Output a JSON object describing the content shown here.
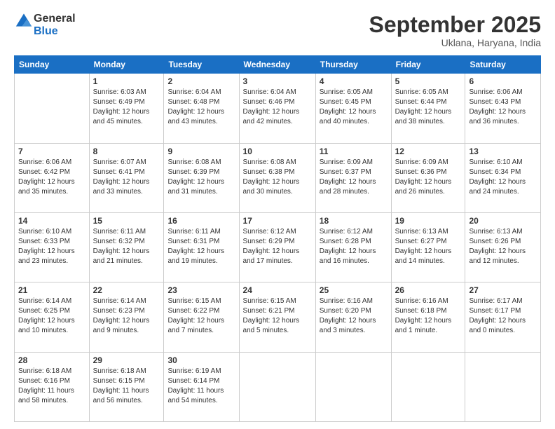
{
  "header": {
    "logo": {
      "line1": "General",
      "line2": "Blue"
    },
    "title": "September 2025",
    "subtitle": "Uklana, Haryana, India"
  },
  "calendar": {
    "days_of_week": [
      "Sunday",
      "Monday",
      "Tuesday",
      "Wednesday",
      "Thursday",
      "Friday",
      "Saturday"
    ],
    "weeks": [
      [
        {
          "day": "",
          "info": ""
        },
        {
          "day": "1",
          "info": "Sunrise: 6:03 AM\nSunset: 6:49 PM\nDaylight: 12 hours\nand 45 minutes."
        },
        {
          "day": "2",
          "info": "Sunrise: 6:04 AM\nSunset: 6:48 PM\nDaylight: 12 hours\nand 43 minutes."
        },
        {
          "day": "3",
          "info": "Sunrise: 6:04 AM\nSunset: 6:46 PM\nDaylight: 12 hours\nand 42 minutes."
        },
        {
          "day": "4",
          "info": "Sunrise: 6:05 AM\nSunset: 6:45 PM\nDaylight: 12 hours\nand 40 minutes."
        },
        {
          "day": "5",
          "info": "Sunrise: 6:05 AM\nSunset: 6:44 PM\nDaylight: 12 hours\nand 38 minutes."
        },
        {
          "day": "6",
          "info": "Sunrise: 6:06 AM\nSunset: 6:43 PM\nDaylight: 12 hours\nand 36 minutes."
        }
      ],
      [
        {
          "day": "7",
          "info": "Sunrise: 6:06 AM\nSunset: 6:42 PM\nDaylight: 12 hours\nand 35 minutes."
        },
        {
          "day": "8",
          "info": "Sunrise: 6:07 AM\nSunset: 6:41 PM\nDaylight: 12 hours\nand 33 minutes."
        },
        {
          "day": "9",
          "info": "Sunrise: 6:08 AM\nSunset: 6:39 PM\nDaylight: 12 hours\nand 31 minutes."
        },
        {
          "day": "10",
          "info": "Sunrise: 6:08 AM\nSunset: 6:38 PM\nDaylight: 12 hours\nand 30 minutes."
        },
        {
          "day": "11",
          "info": "Sunrise: 6:09 AM\nSunset: 6:37 PM\nDaylight: 12 hours\nand 28 minutes."
        },
        {
          "day": "12",
          "info": "Sunrise: 6:09 AM\nSunset: 6:36 PM\nDaylight: 12 hours\nand 26 minutes."
        },
        {
          "day": "13",
          "info": "Sunrise: 6:10 AM\nSunset: 6:34 PM\nDaylight: 12 hours\nand 24 minutes."
        }
      ],
      [
        {
          "day": "14",
          "info": "Sunrise: 6:10 AM\nSunset: 6:33 PM\nDaylight: 12 hours\nand 23 minutes."
        },
        {
          "day": "15",
          "info": "Sunrise: 6:11 AM\nSunset: 6:32 PM\nDaylight: 12 hours\nand 21 minutes."
        },
        {
          "day": "16",
          "info": "Sunrise: 6:11 AM\nSunset: 6:31 PM\nDaylight: 12 hours\nand 19 minutes."
        },
        {
          "day": "17",
          "info": "Sunrise: 6:12 AM\nSunset: 6:29 PM\nDaylight: 12 hours\nand 17 minutes."
        },
        {
          "day": "18",
          "info": "Sunrise: 6:12 AM\nSunset: 6:28 PM\nDaylight: 12 hours\nand 16 minutes."
        },
        {
          "day": "19",
          "info": "Sunrise: 6:13 AM\nSunset: 6:27 PM\nDaylight: 12 hours\nand 14 minutes."
        },
        {
          "day": "20",
          "info": "Sunrise: 6:13 AM\nSunset: 6:26 PM\nDaylight: 12 hours\nand 12 minutes."
        }
      ],
      [
        {
          "day": "21",
          "info": "Sunrise: 6:14 AM\nSunset: 6:25 PM\nDaylight: 12 hours\nand 10 minutes."
        },
        {
          "day": "22",
          "info": "Sunrise: 6:14 AM\nSunset: 6:23 PM\nDaylight: 12 hours\nand 9 minutes."
        },
        {
          "day": "23",
          "info": "Sunrise: 6:15 AM\nSunset: 6:22 PM\nDaylight: 12 hours\nand 7 minutes."
        },
        {
          "day": "24",
          "info": "Sunrise: 6:15 AM\nSunset: 6:21 PM\nDaylight: 12 hours\nand 5 minutes."
        },
        {
          "day": "25",
          "info": "Sunrise: 6:16 AM\nSunset: 6:20 PM\nDaylight: 12 hours\nand 3 minutes."
        },
        {
          "day": "26",
          "info": "Sunrise: 6:16 AM\nSunset: 6:18 PM\nDaylight: 12 hours\nand 1 minute."
        },
        {
          "day": "27",
          "info": "Sunrise: 6:17 AM\nSunset: 6:17 PM\nDaylight: 12 hours\nand 0 minutes."
        }
      ],
      [
        {
          "day": "28",
          "info": "Sunrise: 6:18 AM\nSunset: 6:16 PM\nDaylight: 11 hours\nand 58 minutes."
        },
        {
          "day": "29",
          "info": "Sunrise: 6:18 AM\nSunset: 6:15 PM\nDaylight: 11 hours\nand 56 minutes."
        },
        {
          "day": "30",
          "info": "Sunrise: 6:19 AM\nSunset: 6:14 PM\nDaylight: 11 hours\nand 54 minutes."
        },
        {
          "day": "",
          "info": ""
        },
        {
          "day": "",
          "info": ""
        },
        {
          "day": "",
          "info": ""
        },
        {
          "day": "",
          "info": ""
        }
      ]
    ]
  }
}
